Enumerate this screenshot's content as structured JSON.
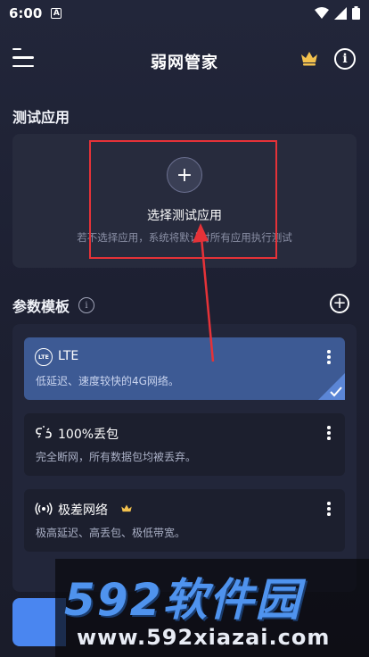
{
  "status_bar": {
    "time": "6:00",
    "notif_badge": "A"
  },
  "app_bar": {
    "title": "弱网管家"
  },
  "test_apps": {
    "section_title": "测试应用",
    "add_symbol": "+",
    "add_label": "选择测试应用",
    "hint": "若不选择应用，系统将默认对所有应用执行测试"
  },
  "templates": {
    "section_title": "参数模板",
    "info_symbol": "i",
    "add_symbol": "+",
    "items": [
      {
        "name": "LTE",
        "badge": "LTE",
        "desc": "低延迟、速度较快的4G网络。",
        "icon": "lte-badge-icon",
        "selected": true
      },
      {
        "name": "100%丢包",
        "desc": "完全断网，所有数据包均被丢弃。",
        "icon": "broken-link-icon",
        "selected": false
      },
      {
        "name": "极差网络",
        "desc": "极高延迟、高丢包、极低带宽。",
        "icon": "broadcast-signal-icon",
        "premium": true,
        "selected": false
      }
    ]
  },
  "watermark": {
    "brand": "592软件园",
    "url": "www.592xiazai.com"
  },
  "colors": {
    "accent": "#4a86f0",
    "selected_card": "#3d5a94",
    "highlight": "#e53238",
    "crown": "#f2c14e"
  }
}
